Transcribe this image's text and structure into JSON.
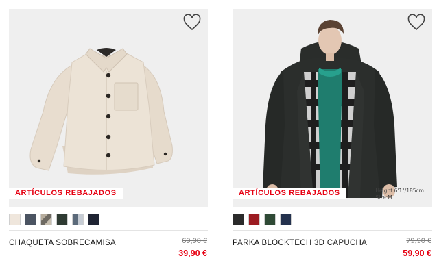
{
  "products": [
    {
      "name": "CHAQUETA SOBRECAMISA",
      "badge": "ARTÍCULOS REBAJADOS",
      "old_price": "69,90 €",
      "new_price": "39,90 €",
      "favorite_icon": "heart-outline-icon",
      "image": "cream-overshirt-jacket",
      "swatches": [
        "#efe6dc",
        "#4b5462",
        "#8a8578",
        "#2f3b33",
        "#5b6a7a",
        "#1f2433"
      ]
    },
    {
      "name": "PARKA BLOCKTECH 3D CAPUCHA",
      "badge": "ARTÍCULOS REBAJADOS",
      "old_price": "79,90 €",
      "new_price": "59,90 €",
      "favorite_icon": "heart-outline-icon",
      "image": "model-wearing-black-hooded-parka",
      "height_note_1": "Height:6'1\"/185cm",
      "height_note_2": "Size:M",
      "swatches": [
        "#2b2b2b",
        "#9c1c22",
        "#2f4a36",
        "#24324e"
      ]
    }
  ],
  "colors": {
    "sale_red": "#e60012",
    "image_bg": "#efefef",
    "text": "#1b1b1b",
    "strike": "#7d7d7d"
  }
}
